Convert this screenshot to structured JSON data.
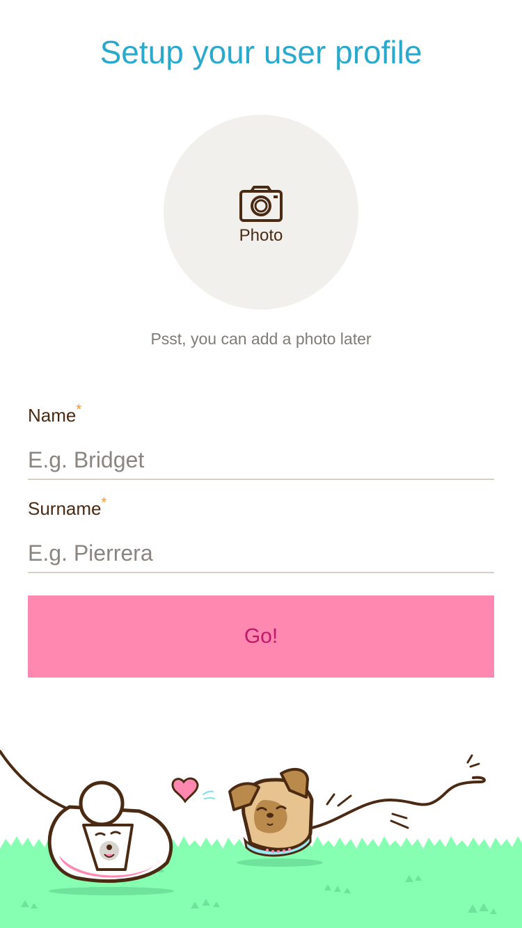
{
  "header": {
    "title": "Setup your user profile"
  },
  "photo": {
    "label": "Photo",
    "hint": "Psst, you can add a photo later"
  },
  "form": {
    "name": {
      "label": "Name",
      "required_mark": "*",
      "placeholder": "E.g. Bridget",
      "value": ""
    },
    "surname": {
      "label": "Surname",
      "required_mark": "*",
      "placeholder": "E.g. Pierrera",
      "value": ""
    },
    "submit_label": "Go!"
  },
  "colors": {
    "title": "#29aacc",
    "accent_required": "#f29531",
    "button_bg": "#ff88b1",
    "button_text": "#c2186b",
    "grass": "#86ffb3",
    "text_dark": "#4a2a12"
  },
  "icons": {
    "photo": "camera-icon"
  }
}
